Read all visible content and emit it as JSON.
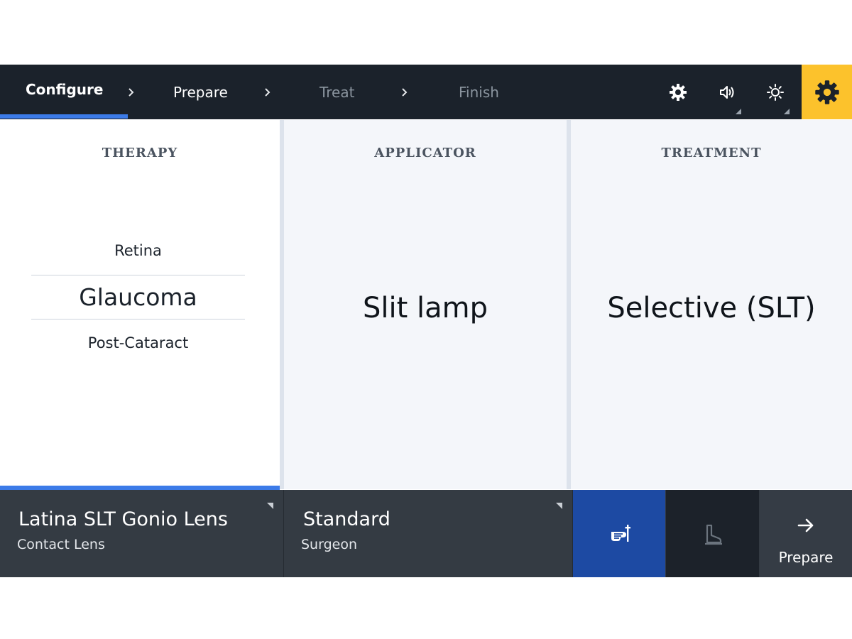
{
  "steps": [
    {
      "label": "Configure",
      "state": "active"
    },
    {
      "label": "Prepare",
      "state": "enabled"
    },
    {
      "label": "Treat",
      "state": "disabled"
    },
    {
      "label": "Finish",
      "state": "disabled"
    }
  ],
  "toolbar": {
    "icons": [
      "gear-icon",
      "volume-icon",
      "brightness-icon",
      "settings-icon"
    ],
    "settings_bg": "#fcc22c"
  },
  "panels": {
    "therapy": {
      "title": "THERAPY",
      "options": [
        "Retina",
        "Glaucoma",
        "Post-Cataract"
      ],
      "selected": "Glaucoma"
    },
    "applicator": {
      "title": "APPLICATOR",
      "value": "Slit lamp"
    },
    "treatment": {
      "title": "TREATMENT",
      "value": "Selective (SLT)"
    }
  },
  "bottom": {
    "lens": {
      "value": "Latina SLT Gonio Lens",
      "label": "Contact Lens"
    },
    "mode": {
      "value": "Standard",
      "label": "Surgeon"
    },
    "hand_button": {
      "icon": "hand-control-icon",
      "active": true
    },
    "foot_button": {
      "icon": "footswitch-icon",
      "active": false
    },
    "next_button": {
      "icon": "arrow-right-icon",
      "label": "Prepare"
    }
  },
  "colors": {
    "accent": "#3c7be8",
    "topbar": "#1b222b",
    "bottombar": "#343b43",
    "active_blue": "#1d4aa3"
  }
}
